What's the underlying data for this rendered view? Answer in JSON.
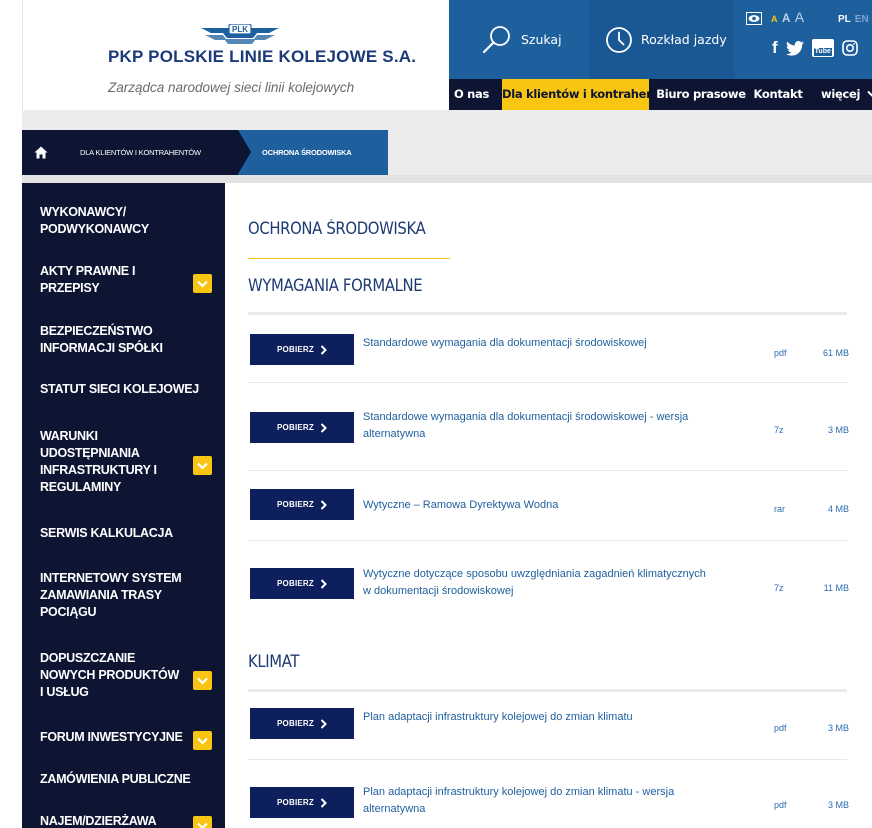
{
  "header": {
    "logo_mark": "PLK",
    "title": "PKP POLSKIE LINIE KOLEJOWE S.A.",
    "subtitle": "Zarządca narodowej sieci linii kolejowych",
    "search_label": "Szukaj",
    "timetable_label": "Rozkład jazdy",
    "font_size_labels": [
      "A",
      "A",
      "A"
    ],
    "lang_pl": "PL",
    "lang_en": "EN",
    "social_youtube_top": "You",
    "social_youtube_bottom": "Tube"
  },
  "nav": {
    "items": [
      "O nas",
      "Dla klientów i kontrahentów",
      "Biuro prasowe",
      "Kontakt",
      "więcej"
    ],
    "active_index": 1
  },
  "breadcrumb": {
    "items": [
      "DLA KLIENTÓW I KONTRAHENTÓW",
      "OCHRONA ŚRODOWISKA"
    ]
  },
  "sidebar": {
    "items": [
      {
        "lines": [
          "WYKONAWCY/",
          "PODWYKONAWCY"
        ],
        "expandable": false
      },
      {
        "lines": [
          "AKTY PRAWNE I",
          "PRZEPISY"
        ],
        "expandable": true
      },
      {
        "lines": [
          "BEZPIECZEŃSTWO",
          "INFORMACJI SPÓŁKI"
        ],
        "expandable": false
      },
      {
        "lines": [
          "STATUT SIECI KOLEJOWEJ"
        ],
        "expandable": false
      },
      {
        "lines": [
          "WARUNKI",
          "UDOSTĘPNIANIA",
          "INFRASTRUKTURY I",
          "REGULAMINY"
        ],
        "expandable": true
      },
      {
        "lines": [
          "SERWIS KALKULACJA"
        ],
        "expandable": false
      },
      {
        "lines": [
          "INTERNETOWY SYSTEM",
          "ZAMAWIANIA TRASY",
          "POCIĄGU"
        ],
        "expandable": false
      },
      {
        "lines": [
          "DOPUSZCZANIE",
          "NOWYCH PRODUKTÓW",
          "I USŁUG"
        ],
        "expandable": true
      },
      {
        "lines": [
          "FORUM INWESTYCYJNE"
        ],
        "expandable": true
      },
      {
        "lines": [
          "ZAMÓWIENIA PUBLICZNE"
        ],
        "expandable": false
      },
      {
        "lines": [
          "NAJEM/DZIERŻAWA"
        ],
        "expandable": true
      }
    ]
  },
  "main": {
    "page_title": "OCHRONA ŚRODOWISKA",
    "download_label": "POBIERZ",
    "sections": [
      {
        "heading": "WYMAGANIA FORMALNE",
        "documents": [
          {
            "lines": [
              "Standardowe wymagania dla dokumentacji środowiskowej"
            ],
            "type": "pdf",
            "size": "61 MB"
          },
          {
            "lines": [
              "Standardowe wymagania dla dokumentacji środowiskowej - wersja",
              "alternatywna"
            ],
            "type": "7z",
            "size": "3 MB"
          },
          {
            "lines": [
              "Wytyczne – Ramowa Dyrektywa Wodna"
            ],
            "type": "rar",
            "size": "4 MB"
          },
          {
            "lines": [
              "Wytyczne dotyczące sposobu uwzględniania zagadnień klimatycznych",
              "w dokumentacji środowiskowej"
            ],
            "type": "7z",
            "size": "11 MB"
          }
        ]
      },
      {
        "heading": "KLIMAT",
        "documents": [
          {
            "lines": [
              "Plan adaptacji infrastruktury kolejowej do zmian klimatu"
            ],
            "type": "pdf",
            "size": "3 MB"
          },
          {
            "lines": [
              "Plan adaptacji infrastruktury kolejowej do zmian klimatu - wersja",
              "alternatywna"
            ],
            "type": "pdf",
            "size": "3 MB"
          }
        ]
      }
    ]
  },
  "colors": {
    "navy": "#0d1533",
    "blue": "#1e5f9e",
    "yellow": "#f7c512"
  }
}
